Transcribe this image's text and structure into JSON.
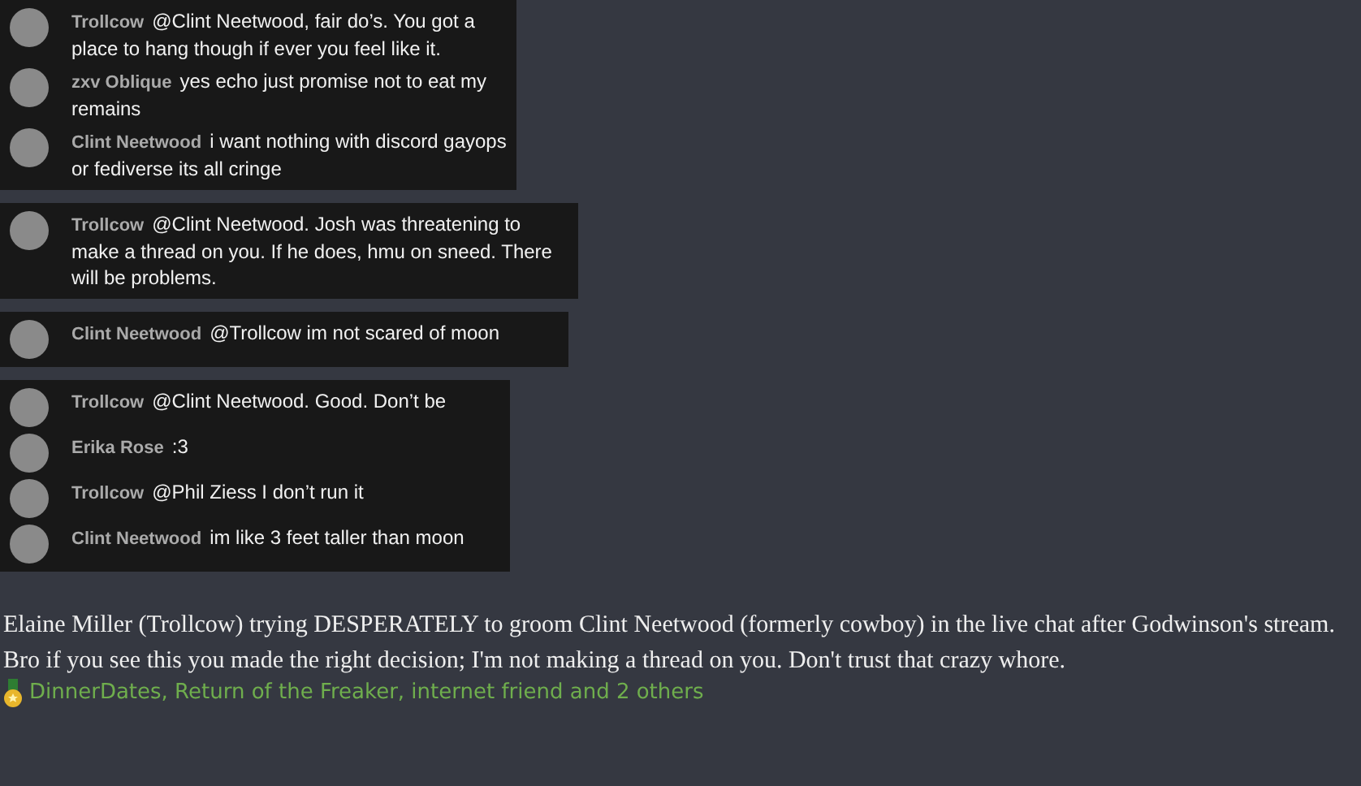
{
  "chat_blocks": [
    {
      "messages": [
        {
          "author": "Trollcow",
          "text": "@Clint Neetwood, fair do’s. You got a place to hang though if ever you feel like it."
        },
        {
          "author": "zxv Oblique",
          "text": "yes echo just promise not to eat my remains"
        },
        {
          "author": "Clint Neetwood",
          "text": "i want nothing with discord gayops or fediverse its all cringe"
        }
      ]
    },
    {
      "messages": [
        {
          "author": "Trollcow",
          "text": "@Clint Neetwood. Josh was threatening to make a thread on you. If he does, hmu on sneed. There will be problems."
        }
      ]
    },
    {
      "messages": [
        {
          "author": "Clint Neetwood",
          "text": "@Trollcow im not scared of moon"
        }
      ]
    },
    {
      "messages": [
        {
          "author": "Trollcow",
          "text": "@Clint Neetwood. Good. Don’t be"
        },
        {
          "author": "Erika Rose",
          "text": ":3"
        },
        {
          "author": "Trollcow",
          "text": "@Phil Ziess I don’t run it"
        },
        {
          "author": "Clint Neetwood",
          "text": "im like 3 feet taller than moon"
        }
      ]
    }
  ],
  "post": {
    "paragraphs": [
      "Elaine Miller (Trollcow) trying DESPERATELY to groom Clint Neetwood (formerly cowboy) in the live chat after Godwinson's stream.",
      "Bro if you see this you made the right decision; I'm not making a thread on you. Don't trust that crazy whore."
    ]
  },
  "reactions": {
    "text": "DinnerDates, Return of the Freaker, internet friend and 2 others"
  }
}
